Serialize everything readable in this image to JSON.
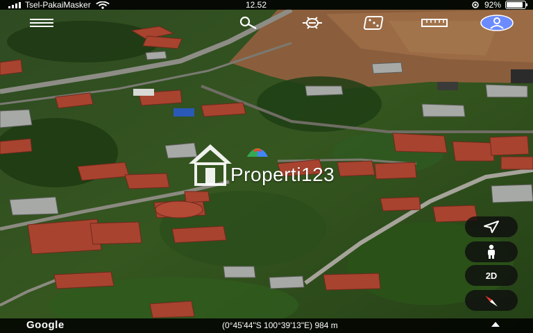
{
  "status": {
    "carrier": "Tsel-PakaiMasker",
    "time": "12.52",
    "battery": "92%",
    "battery_level": 0.92
  },
  "toolbar": {
    "items": [
      "menu-icon",
      "search-icon",
      "voyager-icon",
      "dice-icon",
      "ruler-icon",
      "profile-icon"
    ]
  },
  "watermark": {
    "brand": "Properti123",
    "logo": "house-logo"
  },
  "controls": {
    "navigate_icon": "navigate-arrow-icon",
    "pegman_icon": "pegman-icon",
    "view_mode": "2D",
    "compass_icon": "compass-icon"
  },
  "bottom": {
    "brand": "Google",
    "coordinates": "(0°45'44\"S 100°39'13\"E) 984 m",
    "expand_icon": "chevron-up-icon"
  },
  "colors": {
    "accent": "#6c8bff",
    "compass_red": "#e53935",
    "bar": "#000000"
  }
}
